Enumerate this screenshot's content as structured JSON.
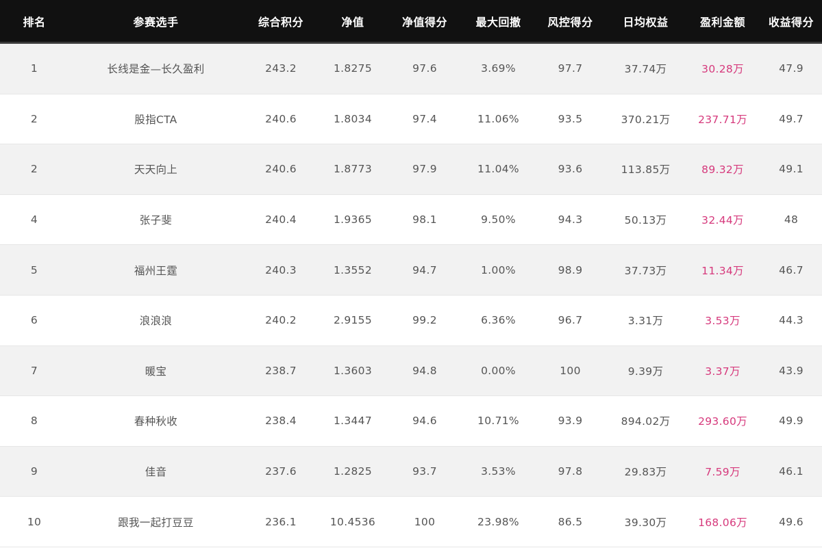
{
  "colors": {
    "header_bg": "#111111",
    "header_text": "#ffffff",
    "row_alt_bg": "#f2f2f2",
    "text": "#555555",
    "profit": "#d6397c"
  },
  "headers": [
    "排名",
    "参赛选手",
    "综合积分",
    "净值",
    "净值得分",
    "最大回撤",
    "风控得分",
    "日均权益",
    "盈利金额",
    "收益得分"
  ],
  "rows": [
    [
      "1",
      "长线是金—长久盈利",
      "243.2",
      "1.8275",
      "97.6",
      "3.69%",
      "97.7",
      "37.74万",
      "30.28万",
      "47.9"
    ],
    [
      "2",
      "股指CTA",
      "240.6",
      "1.8034",
      "97.4",
      "11.06%",
      "93.5",
      "370.21万",
      "237.71万",
      "49.7"
    ],
    [
      "2",
      "天天向上",
      "240.6",
      "1.8773",
      "97.9",
      "11.04%",
      "93.6",
      "113.85万",
      "89.32万",
      "49.1"
    ],
    [
      "4",
      "张子斐",
      "240.4",
      "1.9365",
      "98.1",
      "9.50%",
      "94.3",
      "50.13万",
      "32.44万",
      "48"
    ],
    [
      "5",
      "福州王霆",
      "240.3",
      "1.3552",
      "94.7",
      "1.00%",
      "98.9",
      "37.73万",
      "11.34万",
      "46.7"
    ],
    [
      "6",
      "浪浪浪",
      "240.2",
      "2.9155",
      "99.2",
      "6.36%",
      "96.7",
      "3.31万",
      "3.53万",
      "44.3"
    ],
    [
      "7",
      "暖宝",
      "238.7",
      "1.3603",
      "94.8",
      "0.00%",
      "100",
      "9.39万",
      "3.37万",
      "43.9"
    ],
    [
      "8",
      "春种秋收",
      "238.4",
      "1.3447",
      "94.6",
      "10.71%",
      "93.9",
      "894.02万",
      "293.60万",
      "49.9"
    ],
    [
      "9",
      "佳音",
      "237.6",
      "1.2825",
      "93.7",
      "3.53%",
      "97.8",
      "29.83万",
      "7.59万",
      "46.1"
    ],
    [
      "10",
      "跟我一起打豆豆",
      "236.1",
      "10.4536",
      "100",
      "23.98%",
      "86.5",
      "39.30万",
      "168.06万",
      "49.6"
    ]
  ]
}
